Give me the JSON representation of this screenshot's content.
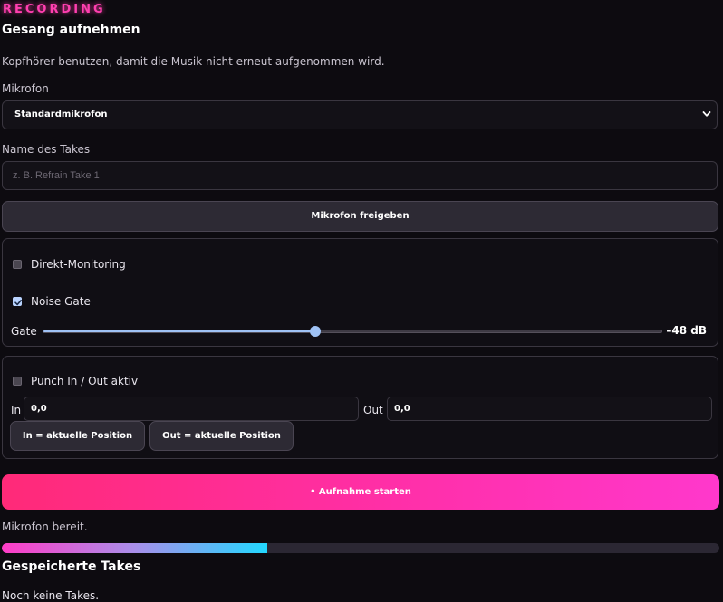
{
  "header": {
    "kicker": "RECORDING",
    "title": "Gesang aufnehmen",
    "hint": "Kopfhörer benutzen, damit die Musik nicht erneut aufgenommen wird."
  },
  "mic": {
    "label": "Mikrofon",
    "selected": "Standardmikrofon"
  },
  "take_name": {
    "label": "Name des Takes",
    "placeholder": "z. B. Refrain Take 1",
    "value": ""
  },
  "grant_button": "Mikrofon freigeben",
  "monitoring": {
    "direct_label": "Direkt-Monitoring",
    "direct_checked": false,
    "gate_toggle_label": "Noise Gate",
    "gate_checked": true,
    "gate_label": "Gate",
    "gate_value_label": "–48 dB",
    "gate_level_fraction": 0.44
  },
  "punch": {
    "label": "Punch In / Out aktiv",
    "checked": false,
    "in_label": "In",
    "in_value": "0,0",
    "out_label": "Out",
    "out_value": "0,0",
    "set_in_button": "In = aktuelle Position",
    "set_out_button": "Out = aktuelle Position"
  },
  "record_button": "• Aufnahme starten",
  "status": "Mikrofon bereit.",
  "input_level_fraction": 0.37,
  "takes": {
    "title": "Gespeicherte Takes",
    "empty": "Noch keine Takes."
  },
  "colors": {
    "accent": "#ff3fb0",
    "slider": "#9fc2f5",
    "record_start": "#ff2a78",
    "record_end": "#ff38cc",
    "meter_end": "#22d8ff"
  },
  "icons": {
    "select": "chevron-down-icon",
    "check": "check-icon"
  }
}
